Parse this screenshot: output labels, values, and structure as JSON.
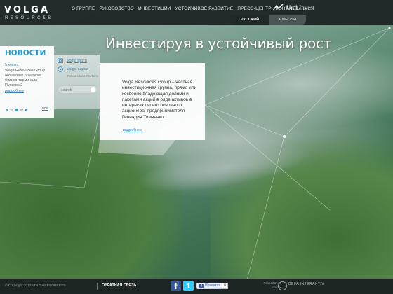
{
  "logo": {
    "name": "VOLGA",
    "sub": "RESOURCES"
  },
  "nav": {
    "items": [
      "О ГРУППЕ",
      "РУКОВОДСТВО",
      "ИНВЕСТИЦИИ",
      "УСТОЙЧИВОЕ РАЗВИТИЕ",
      "ПРЕСС-ЦЕНТР",
      "КОНТАКТЫ"
    ]
  },
  "partner": {
    "name": "Ural Invest",
    "icon": "ural-invest-logo-icon"
  },
  "lang": {
    "ru": "РУССКИЙ",
    "en": "ENGLISH"
  },
  "hero": {
    "title": "Инвестируя в устойчивый рост"
  },
  "news": {
    "title": "НОВОСТИ",
    "date": "5 марта",
    "text": "Volga Resources Group объявляет о запуске бизнес-терминала Пулково 2",
    "more": "подробнее",
    "all": "все",
    "prev_arrow": "◀",
    "next_arrow": "▶"
  },
  "media": {
    "photo": "Volga фото",
    "video": "Volga видео",
    "youtube": "Follow us on YouTube",
    "search_placeholder": "search",
    "icons": {
      "photo": "photo-icon",
      "video": "play-icon",
      "search": "search-go-icon"
    }
  },
  "about": {
    "text": "Volga Resources Group – частная инвестиционная группа, прямо или косвенно владеющая долями и пакетами акций в ряде активов в интересах своего основного акционера, предпринимателя Геннадия Тимченко.",
    "more": "подробнее"
  },
  "footer": {
    "copyright": "© Copyright 2012 VOLGA RESOURCES",
    "feedback": "ОБРАТНАЯ СВЯЗЬ",
    "fb_letter": "f",
    "tw_letter": "t",
    "like_label": "Нравится",
    "like_count": "0",
    "dev_label": "Разработка сайта",
    "dev_name": "DEFA INTERAKTIV"
  },
  "colors": {
    "accent": "#2e9acb",
    "link": "#2e7fb8",
    "topbar": "#1e2424",
    "facebook": "#3b5998",
    "twitter": "#33ccff"
  }
}
